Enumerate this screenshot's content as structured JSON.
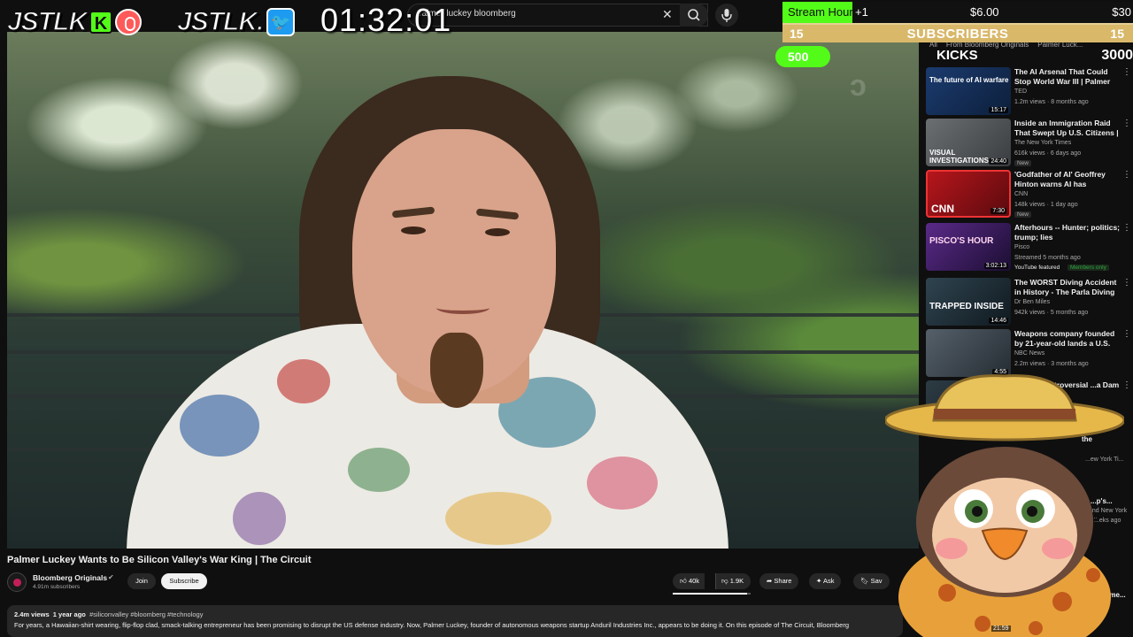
{
  "search": {
    "query": "palmer luckey bloomberg"
  },
  "video": {
    "title": "Palmer Luckey Wants to Be Silicon Valley's War King | The Circuit",
    "watermark": "ɔ"
  },
  "channel": {
    "name": "Bloomberg Originals",
    "subscribers": "4.91m subscribers",
    "join_label": "Join",
    "subscribe_label": "Subscribe"
  },
  "actions": {
    "likes": "40k",
    "dislikes": "1.9K",
    "share_label": "Share",
    "ask_label": "Ask",
    "save_label": "Sav",
    "like_ratio": 0.955
  },
  "description": {
    "views": "2.4m views",
    "age": "1 year ago",
    "tags": "#siliconvalley #bloomberg #technology",
    "text": "For years, a Hawaiian-shirt wearing, flip-flop clad, smack-talking entrepreneur has been promising to disrupt the US defense industry. Now, Palmer Luckey, founder of autonomous weapons startup Anduril Industries Inc., appears to be doing it. On this episode of The Circuit, Bloomberg"
  },
  "stream_overlay": {
    "logo1_text": "JSTLK",
    "kick_letter": "K",
    "logo2_text": "JSTLK.",
    "timer": "01:32:01",
    "hours_label": "Stream Hours",
    "hours_plus": "+1",
    "hours_price_current": "$6.00",
    "hours_price_goal": "$30",
    "hours_progress": 0.2,
    "subs_current": "15",
    "subs_label": "SUBSCRIBERS",
    "subs_goal": "15",
    "kicks_current": "500",
    "kicks_label": "KICKS",
    "kicks_goal": "3000",
    "colors": {
      "kick_green": "#53fc18",
      "subs_gold": "#d9b86a"
    }
  },
  "chips": [
    "All",
    "From Bloomberg Originals",
    "Palmer Luck..."
  ],
  "recommendations": [
    {
      "title": "The AI Arsenal That Could Stop World War III | Palmer Luckey |...",
      "channel": "TED",
      "meta": "1.2m views · 8 months ago",
      "duration": "15:17",
      "thumb_label": "The future of AI warfare",
      "thumb_color": "#1b3b6f"
    },
    {
      "title": "Inside an Immigration Raid That Swept Up U.S. Citizens | Visual...",
      "channel": "The New York Times",
      "meta": "616k views · 6 days ago",
      "badge": "New",
      "duration": "24:40",
      "thumb_label": "VISUAL INVESTIGATIONS",
      "thumb_color": "#4b4f52"
    },
    {
      "title": "'Godfather of AI' Geoffrey Hinton warns AI has 'progress...",
      "channel": "CNN",
      "meta": "148k views · 1 day ago",
      "badge": "New",
      "duration": "7:30",
      "thumb_label": "CNN",
      "thumb_color": "#b7161c"
    },
    {
      "title": "Afterhours -- Hunter; politics; trump; lies",
      "channel": "Pisco",
      "meta": "Streamed 5 months ago",
      "badge": "YouTube featured",
      "members": "Members only",
      "duration": "3:02:13",
      "thumb_label": "PISCO'S HOUR",
      "thumb_color": "#3a1b55"
    },
    {
      "title": "The WORST Diving Accident in History - The Parla Diving ...",
      "channel": "Dr Ben Miles",
      "meta": "942k views · 5 months ago",
      "duration": "14:46",
      "thumb_label": "TRAPPED INSIDE",
      "thumb_color": "#23313a"
    },
    {
      "title": "Weapons company founded by 21-year-old lands a U.S. Army ...",
      "channel": "NBC News",
      "meta": "2.2m views · 3 months ago",
      "duration": "4:55",
      "thumb_label": "",
      "thumb_color": "#3b4550"
    },
    {
      "title": "...ina's Controversial ...a Dam",
      "channel": "",
      "meta": "",
      "duration": "",
      "thumb_label": "",
      "thumb_color": "#2d3b44"
    }
  ],
  "partial_recs": {
    "r1": "the",
    "r2": "...ew York Ti...",
    "r3": "...p's...",
    "r4": "...nd New York Ti...",
    "r5": "...eks ago",
    "r6": "...Prime..."
  },
  "mascot": {
    "clip_time": "21:59"
  }
}
